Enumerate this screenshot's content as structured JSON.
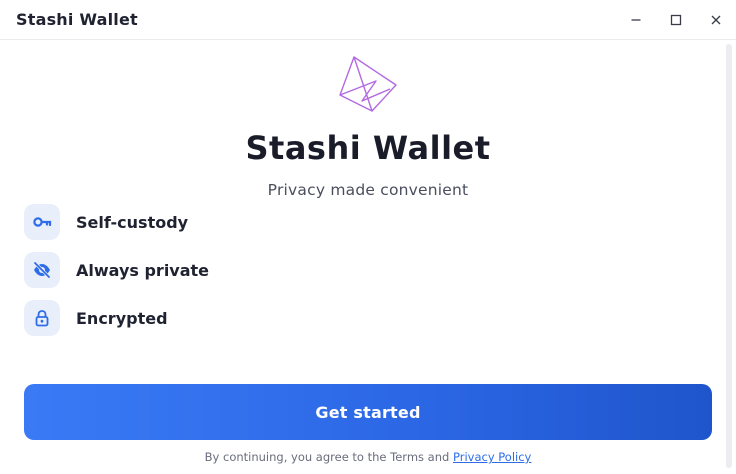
{
  "window": {
    "title": "Stashi Wallet",
    "controls": [
      "minimize-icon",
      "maximize-icon",
      "close-icon"
    ]
  },
  "hero": {
    "title": "Stashi Wallet",
    "subtitle": "Privacy made convenient",
    "logo": "stashi-logo-icon"
  },
  "features": [
    {
      "label": "Self-custody",
      "icon": "key-icon"
    },
    {
      "label": "Always private",
      "icon": "eye-off-icon"
    },
    {
      "label": "Encrypted",
      "icon": "lock-icon"
    }
  ],
  "cta": {
    "label": "Get started"
  },
  "legal": {
    "text": "By continuing, you agree to the Terms and",
    "link": "Privacy Policy"
  },
  "colors": {
    "accent": "#2f6de8",
    "icon_bg": "#e9eefb",
    "logo": "#b36ae0"
  }
}
